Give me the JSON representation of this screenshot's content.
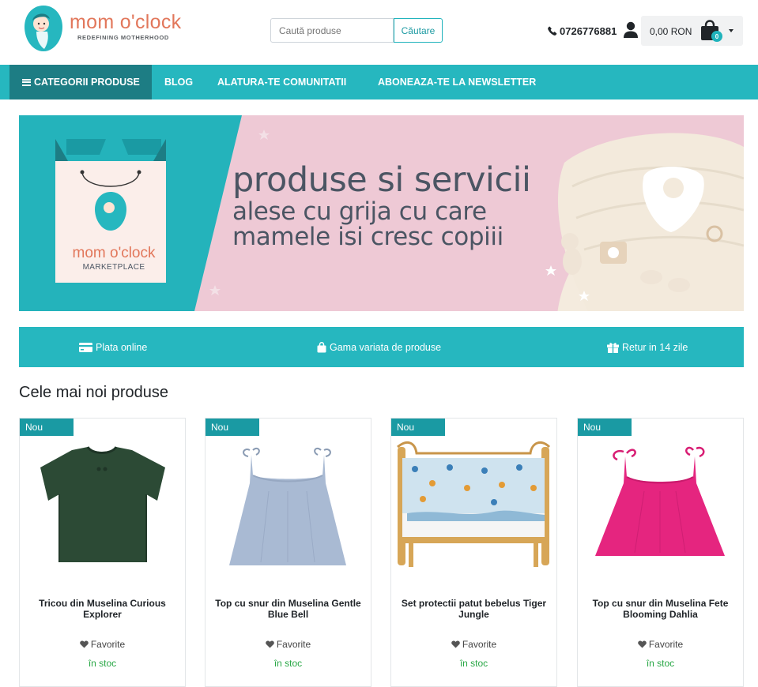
{
  "header": {
    "logo_name": "mom o'clock",
    "logo_tagline": "REDEFINING MOTHERHOOD",
    "search_placeholder": "Caută produse",
    "search_button": "Căutare",
    "phone": "0726776881",
    "cart_amount": "0,00 RON",
    "cart_count": "0"
  },
  "nav": {
    "items": [
      {
        "label": "CATEGORII PRODUSE"
      },
      {
        "label": "BLOG"
      },
      {
        "label": "ALATURA-TE COMUNITATII"
      },
      {
        "label": "ABONEAZA-TE LA NEWSLETTER"
      }
    ]
  },
  "banner": {
    "line1": "produse si servicii",
    "line2": "alese cu grija cu care",
    "line3": "mamele isi cresc copiii",
    "bag_brand": "mom o'clock",
    "bag_sub": "MARKETPLACE"
  },
  "features": [
    {
      "label": "Plata online",
      "icon": "credit-card-icon"
    },
    {
      "label": "Gama variata de produse",
      "icon": "shopping-bag-icon"
    },
    {
      "label": "Retur in 14 zile",
      "icon": "gift-icon"
    }
  ],
  "section_title": "Cele mai noi produse",
  "products": [
    {
      "badge": "Nou",
      "title": "Tricou din Muselina Curious Explorer",
      "favorite": "Favorite",
      "stock": "în stoc"
    },
    {
      "badge": "Nou",
      "title": "Top cu snur din Muselina Gentle Blue Bell",
      "favorite": "Favorite",
      "stock": "în stoc"
    },
    {
      "badge": "Nou",
      "title": "Set protectii patut bebelus Tiger Jungle",
      "favorite": "Favorite",
      "stock": "în stoc"
    },
    {
      "badge": "Nou",
      "title": "Top cu snur din Muselina Fete Blooming Dahlia",
      "favorite": "Favorite",
      "stock": "în stoc"
    }
  ],
  "colors": {
    "brand_teal": "#26b7bf",
    "nav_active": "#1d7d84",
    "brand_coral": "#e2775b",
    "stock_green": "#28a745"
  }
}
